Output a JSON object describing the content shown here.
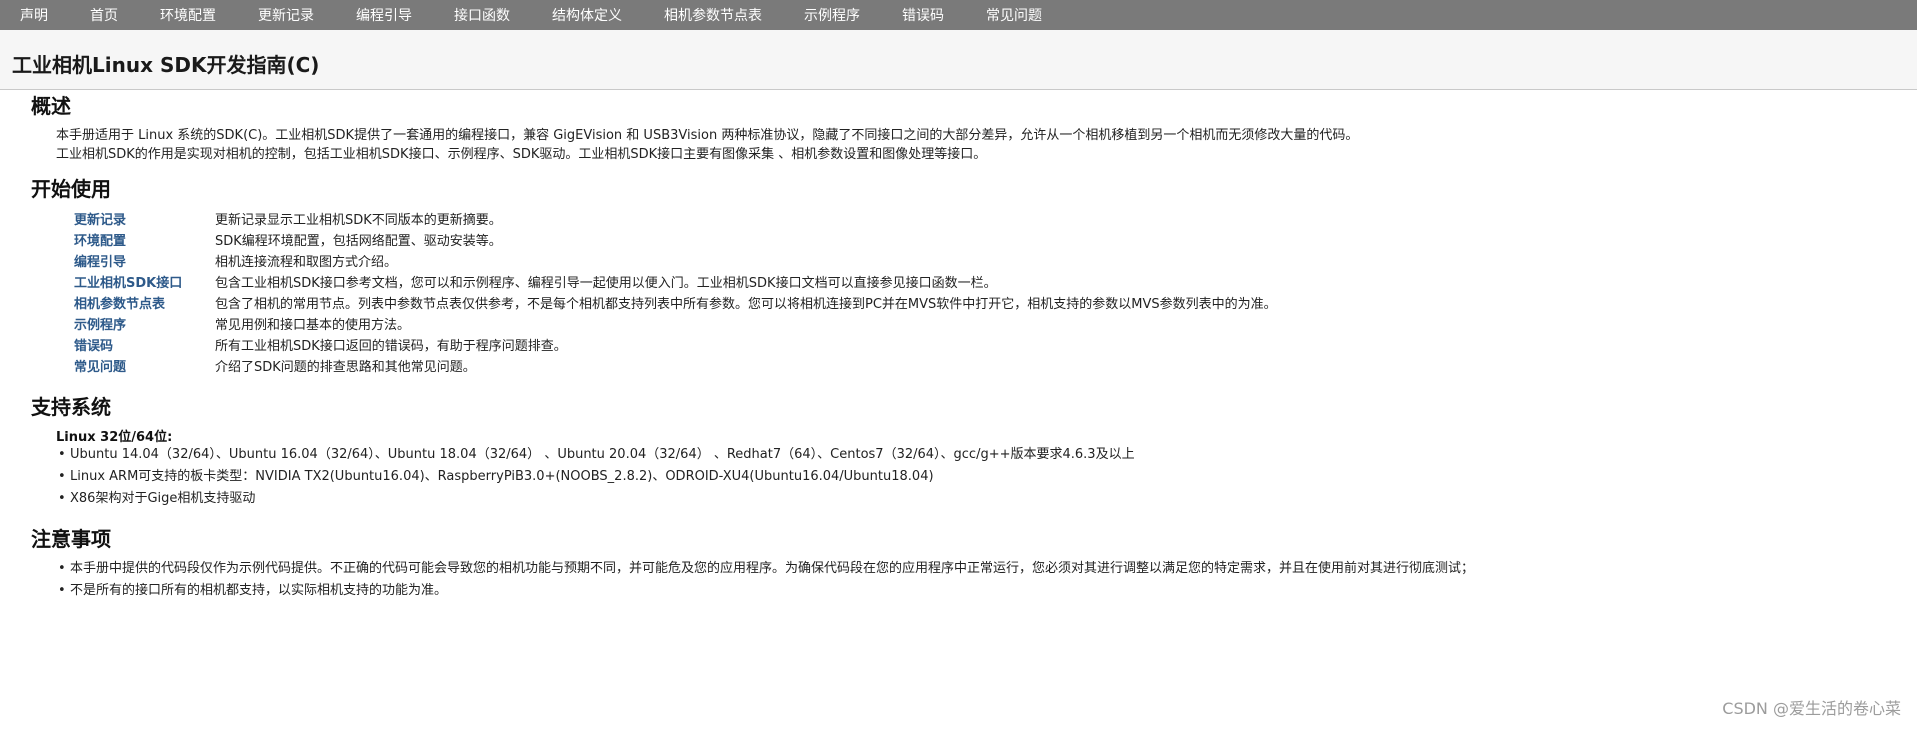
{
  "nav": [
    "声明",
    "首页",
    "环境配置",
    "更新记录",
    "编程引导",
    "接口函数",
    "结构体定义",
    "相机参数节点表",
    "示例程序",
    "错误码",
    "常见问题"
  ],
  "page_title": "工业相机Linux SDK开发指南(C)",
  "sections": {
    "overview": {
      "heading": "概述",
      "p1": "本手册适用于 Linux 系统的SDK(C)。工业相机SDK提供了一套通用的编程接口，兼容 GigEVision 和 USB3Vision 两种标准协议，隐藏了不同接口之间的大部分差异，允许从一个相机移植到另一个相机而无须修改大量的代码。",
      "p2": "工业相机SDK的作用是实现对相机的控制，包括工业相机SDK接口、示例程序、SDK驱动。工业相机SDK接口主要有图像采集 、相机参数设置和图像处理等接口。"
    },
    "start": {
      "heading": "开始使用",
      "items": [
        {
          "label": "更新记录",
          "desc": "更新记录显示工业相机SDK不同版本的更新摘要。"
        },
        {
          "label": "环境配置",
          "desc": "SDK编程环境配置，包括网络配置、驱动安装等。"
        },
        {
          "label": "编程引导",
          "desc": "相机连接流程和取图方式介绍。"
        },
        {
          "label": "工业相机SDK接口",
          "desc": "包含工业相机SDK接口参考文档，您可以和示例程序、编程引导一起使用以便入门。工业相机SDK接口文档可以直接参见接口函数一栏。"
        },
        {
          "label": "相机参数节点表",
          "desc": "包含了相机的常用节点。列表中参数节点表仅供参考，不是每个相机都支持列表中所有参数。您可以将相机连接到PC并在MVS软件中打开它，相机支持的参数以MVS参数列表中的为准。"
        },
        {
          "label": "示例程序",
          "desc": "常见用例和接口基本的使用方法。"
        },
        {
          "label": "错误码",
          "desc": "所有工业相机SDK接口返回的错误码，有助于程序问题排查。"
        },
        {
          "label": "常见问题",
          "desc": "介绍了SDK问题的排查思路和其他常见问题。"
        }
      ]
    },
    "systems": {
      "heading": "支持系统",
      "subheading": "Linux 32位/64位:",
      "items": [
        "Ubuntu 14.04（32/64）、Ubuntu 16.04（32/64）、Ubuntu 18.04（32/64） 、Ubuntu 20.04（32/64） 、Redhat7（64）、Centos7（32/64）、gcc/g++版本要求4.6.3及以上",
        "Linux ARM可支持的板卡类型：NVIDIA TX2(Ubuntu16.04)、RaspberryPiB3.0+(NOOBS_2.8.2)、ODROID-XU4(Ubuntu16.04/Ubuntu18.04)",
        "X86架构对于Gige相机支持驱动"
      ]
    },
    "notes": {
      "heading": "注意事项",
      "items": [
        "本手册中提供的代码段仅作为示例代码提供。不正确的代码可能会导致您的相机功能与预期不同，并可能危及您的应用程序。为确保代码段在您的应用程序中正常运行，您必须对其进行调整以满足您的特定需求，并且在使用前对其进行彻底测试；",
        "不是所有的接口所有的相机都支持，以实际相机支持的功能为准。"
      ]
    }
  },
  "watermark": "CSDN @爱生活的卷心菜"
}
